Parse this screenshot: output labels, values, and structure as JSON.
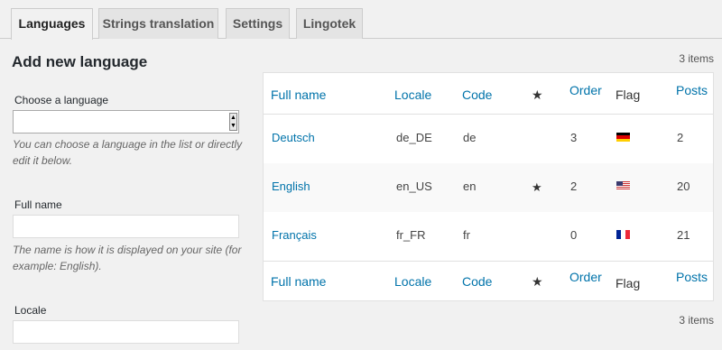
{
  "tabs": [
    "Languages",
    "Strings translation",
    "Settings",
    "Lingotek"
  ],
  "form": {
    "title": "Add new language",
    "choose_label": "Choose a language",
    "choose_value": "",
    "choose_help": "You can choose a language in the list or directly edit it below.",
    "fullname_label": "Full name",
    "fullname_value": "",
    "fullname_help": "The name is how it is displayed on your site (for example: English).",
    "locale_label": "Locale",
    "locale_value": ""
  },
  "items_count": "3 items",
  "table": {
    "headers": {
      "full_name": "Full name",
      "locale": "Locale",
      "code": "Code",
      "default_star": "★",
      "order": "Order",
      "flag": "Flag",
      "posts": "Posts"
    },
    "rows": [
      {
        "name": "Deutsch",
        "locale": "de_DE",
        "code": "de",
        "default": "",
        "order": "3",
        "flag": "de-flag-icon",
        "posts": "2"
      },
      {
        "name": "English",
        "locale": "en_US",
        "code": "en",
        "default": "★",
        "order": "2",
        "flag": "us-flag-icon",
        "posts": "20"
      },
      {
        "name": "Français",
        "locale": "fr_FR",
        "code": "fr",
        "default": "",
        "order": "0",
        "flag": "fr-flag-icon",
        "posts": "21"
      }
    ]
  },
  "colors": {
    "link": "#0073aa",
    "background": "#f1f1f1"
  }
}
